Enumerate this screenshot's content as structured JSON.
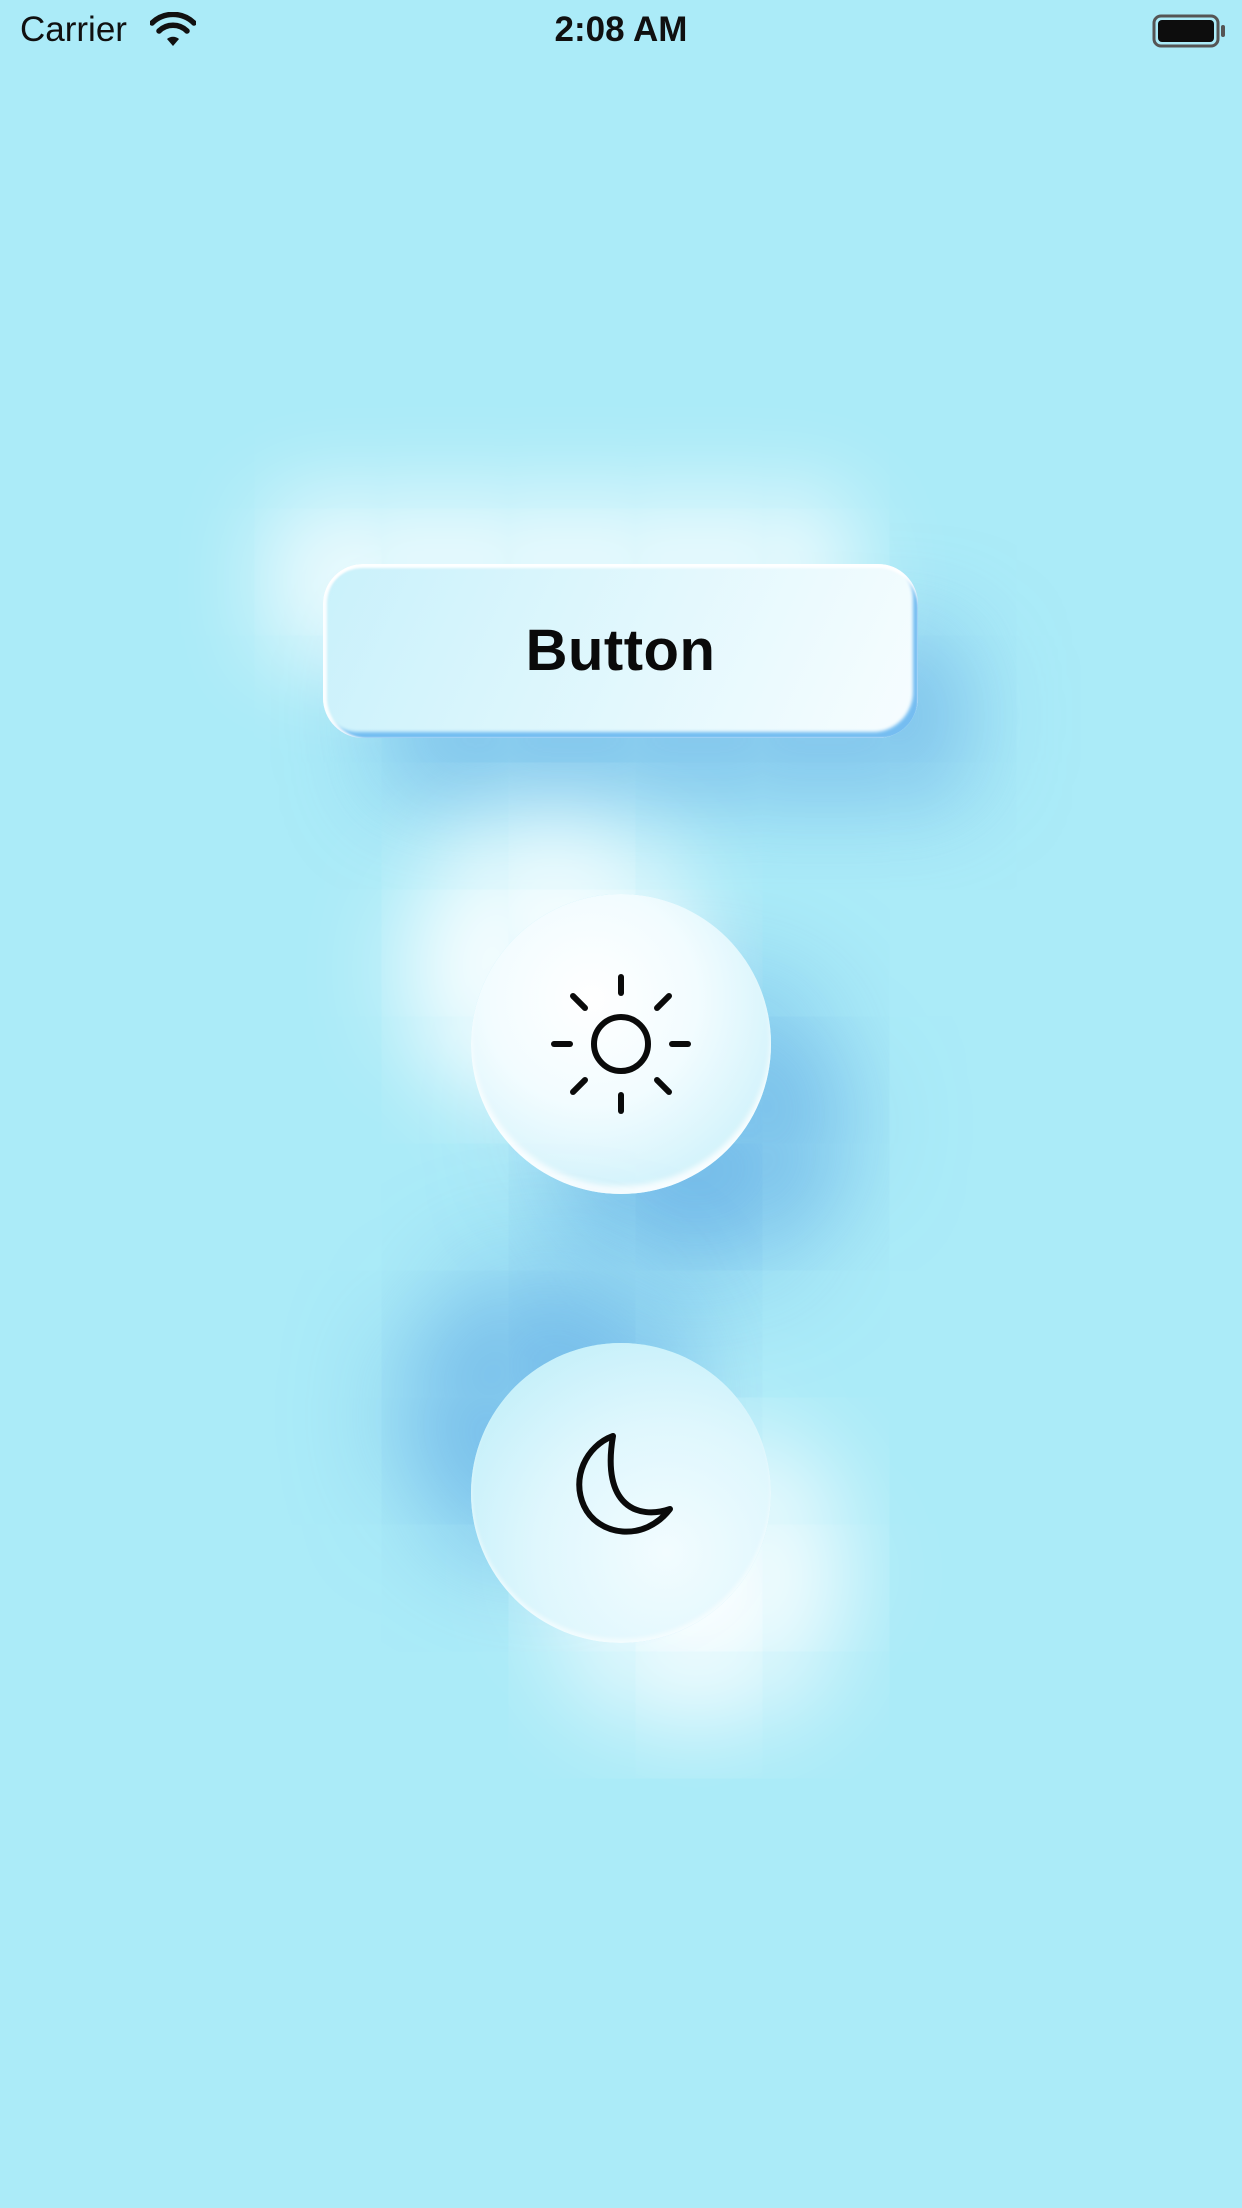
{
  "status_bar": {
    "carrier": "Carrier",
    "time": "2:08 AM",
    "wifi_icon": "wifi-icon",
    "battery_icon": "battery-full-icon"
  },
  "main": {
    "button_label": "Button",
    "sun_button_icon": "sun-icon",
    "moon_button_icon": "moon-icon"
  },
  "colors": {
    "background": "#abebf8",
    "button_surface": "#e3f8fd",
    "shadow_dark": "#5fa5e1",
    "highlight": "#ffffff",
    "text": "#0a0a0a"
  }
}
